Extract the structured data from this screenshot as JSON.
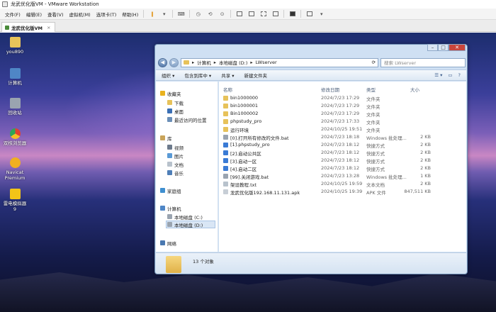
{
  "window": {
    "title": "龙武优化版VM - VMware Workstation"
  },
  "menu": [
    "文件(F)",
    "编辑(E)",
    "查看(V)",
    "虚拟机(M)",
    "选项卡(T)",
    "帮助(H)"
  ],
  "tab": {
    "label": "龙武优化版VM",
    "close": "×"
  },
  "desktop_icons": [
    {
      "label": "you890",
      "color": "#e8c35a"
    },
    {
      "label": "计算机",
      "color": "#4f86c6"
    },
    {
      "label": "回收站",
      "color": "#9aa4b0"
    },
    {
      "label": "双核浏览器",
      "color": "#e2412f"
    },
    {
      "label": "Navicat\nPremium",
      "color": "#f0b020"
    },
    {
      "label": "雷电模拟器9",
      "color": "#f2c418"
    }
  ],
  "explorer": {
    "address": [
      "计算机",
      "本地磁盘 (D:)",
      "LWserver"
    ],
    "search_placeholder": "搜索 LWserver",
    "toolbar": [
      "组织 ▾",
      "包含到库中 ▾",
      "共享 ▾",
      "新建文件夹"
    ],
    "nav": {
      "favorites": "收藏夹",
      "fav_items": [
        "下载",
        "桌面",
        "最近访问的位置"
      ],
      "libraries": "库",
      "lib_items": [
        "视频",
        "图片",
        "文档",
        "音乐"
      ],
      "homegroup": "家庭组",
      "computer": "计算机",
      "drives": [
        "本地磁盘 (C:)",
        "本地磁盘 (D:)"
      ],
      "network": "网络"
    },
    "columns": [
      "名称",
      "修改日期",
      "类型",
      "大小"
    ],
    "files": [
      {
        "name": "bin1000000",
        "date": "2024/7/23 17:29",
        "type": "文件夹",
        "size": "",
        "kind": "folder"
      },
      {
        "name": "bin1000001",
        "date": "2024/7/23 17:29",
        "type": "文件夹",
        "size": "",
        "kind": "folder"
      },
      {
        "name": "Bin1000002",
        "date": "2024/7/23 17:29",
        "type": "文件夹",
        "size": "",
        "kind": "folder"
      },
      {
        "name": "phpstudy_pro",
        "date": "2024/7/23 17:33",
        "type": "文件夹",
        "size": "",
        "kind": "folder"
      },
      {
        "name": "运行环境",
        "date": "2024/10/25 19:51",
        "type": "文件夹",
        "size": "",
        "kind": "folder"
      },
      {
        "name": "[0].打开所有修改的文件.bat",
        "date": "2024/7/23 18:18",
        "type": "Windows 批处理...",
        "size": "2 KB",
        "kind": "bat"
      },
      {
        "name": "[1].phpstudy_pro",
        "date": "2024/7/23 18:12",
        "type": "快捷方式",
        "size": "2 KB",
        "kind": "lnk"
      },
      {
        "name": "[2].启动公共区",
        "date": "2024/7/23 18:12",
        "type": "快捷方式",
        "size": "2 KB",
        "kind": "lnk"
      },
      {
        "name": "[3].启动一区",
        "date": "2024/7/23 18:12",
        "type": "快捷方式",
        "size": "2 KB",
        "kind": "lnk"
      },
      {
        "name": "[4].启动二区",
        "date": "2024/7/23 18:12",
        "type": "快捷方式",
        "size": "2 KB",
        "kind": "lnk"
      },
      {
        "name": "[99].关闭游戏.bat",
        "date": "2024/7/23 13:28",
        "type": "Windows 批处理...",
        "size": "1 KB",
        "kind": "bat"
      },
      {
        "name": "架设教程.txt",
        "date": "2024/10/25 19:59",
        "type": "文本文档",
        "size": "2 KB",
        "kind": "txt"
      },
      {
        "name": "龙武优化版192.168.11.131.apk",
        "date": "2024/10/25 19:39",
        "type": "APK 文件",
        "size": "847,511 KB",
        "kind": "apk"
      }
    ],
    "status": "13 个对象"
  },
  "colors": {
    "folder": "#e7c25a",
    "bat": "#9aa4b0",
    "lnk": "#3a7bd5",
    "txt": "#b8c2cc",
    "apk": "#c7ced6"
  }
}
